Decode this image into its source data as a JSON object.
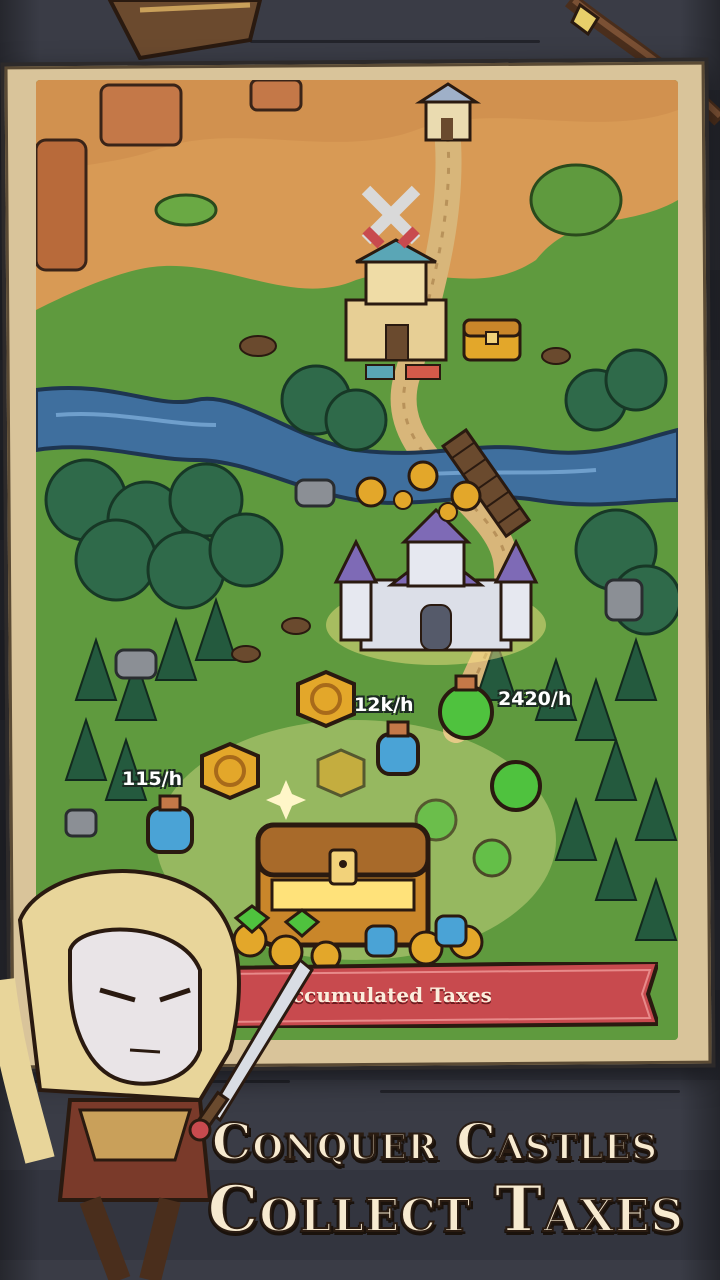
{
  "map": {
    "rates": {
      "gold_rate": "12k/h",
      "potion_rate": "2420/h",
      "mana_rate": "115/h"
    },
    "coin_symbol": "G"
  },
  "banner": {
    "label": "ccumulated Taxes"
  },
  "headline": {
    "line1": "Conquer Castles",
    "line2": "Collect Taxes"
  },
  "colors": {
    "grass": "#5f9a3e",
    "dirt": "#d89a55",
    "river": "#3f6f9e",
    "forest": "#2f6a4a",
    "gold": "#e3a72a",
    "ribbon": "#c84a4e",
    "potion_green": "#4fc23e"
  },
  "icons": [
    "crossed-swords-icon",
    "treasure-chest-icon",
    "castle-icon",
    "gold-coin-icon",
    "green-potion-icon",
    "blue-potion-icon",
    "sparkle-icon"
  ]
}
